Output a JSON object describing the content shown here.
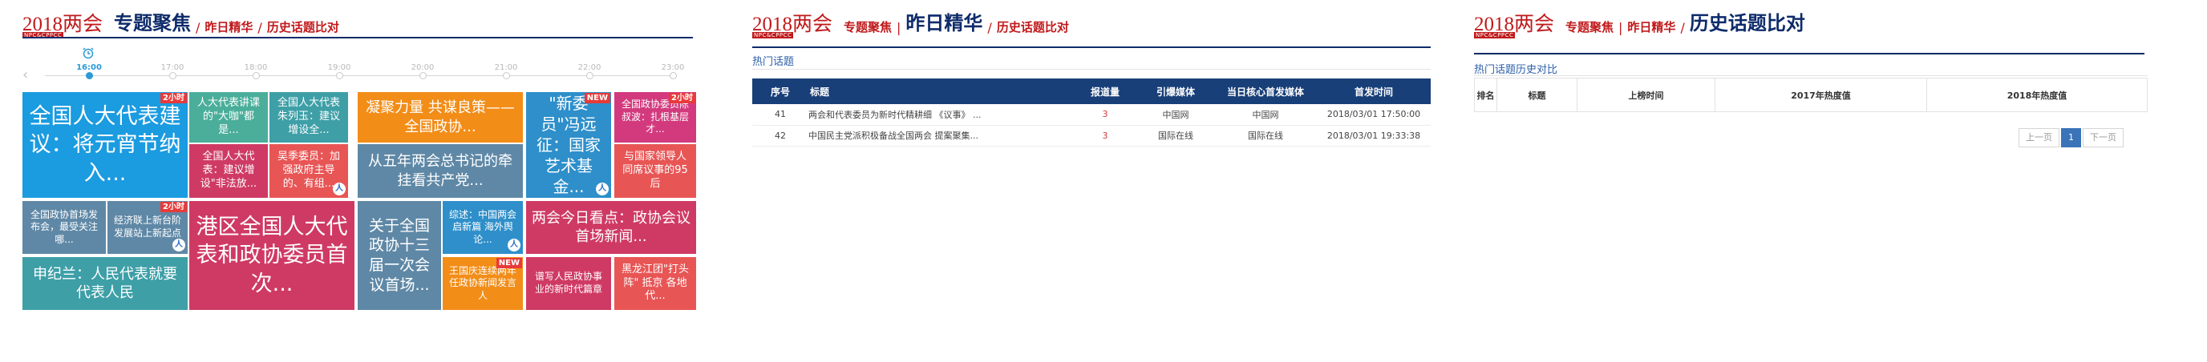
{
  "brand": {
    "year_text": "2018",
    "lianghui_text": "两会",
    "en_text": "NPC&CPPCC"
  },
  "panel1": {
    "title": "专题聚焦",
    "links": [
      "昨日精华",
      "历史话题比对"
    ],
    "timeline": {
      "clock_icon": "alarm-clock-icon",
      "times": [
        "16:00",
        "17:00",
        "18:00",
        "19:00",
        "20:00",
        "21:00",
        "22:00",
        "23:00"
      ],
      "active_index": 0
    },
    "tiles": [
      {
        "text": "全国人大代表建议：将元宵节纳入...",
        "badge": "2小时"
      },
      {
        "text": "人大代表讲课的\"大咖\"都是..."
      },
      {
        "text": "全国人大代表朱列玉：建议增设全..."
      },
      {
        "text": "凝聚力量 共谋良策——全国政协..."
      },
      {
        "text": "\"新委员\"冯远征：国家艺术基金...",
        "badge": "NEW"
      },
      {
        "text": "全国政协委员陈叔波：扎根基层才...",
        "badge": "2小时"
      },
      {
        "text": "全国人大代表：建议增设\"非法放..."
      },
      {
        "text": "吴季委员：加强政府主导的、有组..."
      },
      {
        "text": "从五年两会总书记的牵挂看共产党..."
      },
      {
        "text": "与国家领导人同席议事的95后"
      },
      {
        "text": "全国政协首场发布会，最受关注哪..."
      },
      {
        "text": "经济联上新台阶 发展站上新起点",
        "badge": "2小时"
      },
      {
        "text": "港区全国人大代表和政协委员首次..."
      },
      {
        "text": "关于全国政协十三届一次会议首场..."
      },
      {
        "text": "综述：中国两会启新篇 海外舆论..."
      },
      {
        "text": "两会今日看点：政协会议首场新闻..."
      },
      {
        "text": "申纪兰：人民代表就要代表人民"
      },
      {
        "text": "王国庆连续两年任政协新闻发言人",
        "badge": "NEW"
      },
      {
        "text": "谱写人民政协事业的新时代篇章"
      },
      {
        "text": "黑龙江团\"打头阵\" 抵京 各地代..."
      }
    ]
  },
  "panel2": {
    "title": "昨日精华",
    "links": [
      "专题聚焦",
      "历史话题比对"
    ],
    "subtitle": "热门话题",
    "columns": [
      "序号",
      "标题",
      "报道量",
      "引爆媒体",
      "当日核心首发媒体",
      "首发时间"
    ],
    "rows": [
      [
        "41",
        "两会和代表委员为新时代精耕细  《议事》 ...",
        "3",
        "中国网",
        "中国网",
        "2018/03/01 17:50:00"
      ],
      [
        "42",
        "中国民主党派积极备战全国两会 提案聚集...",
        "3",
        "国际在线",
        "国际在线",
        "2018/03/01 19:33:38"
      ]
    ]
  },
  "panel3": {
    "title": "历史话题比对",
    "links": [
      "专题聚焦",
      "昨日精华"
    ],
    "subtitle": "热门话题历史对比",
    "columns": [
      "排名",
      "标题",
      "上榜时间",
      "2017年热度值",
      "2018年热度值"
    ],
    "pager": {
      "prev": "上一页",
      "page": "1",
      "next": "下一页"
    }
  },
  "colors": {
    "brand_red": "#c0191b",
    "navy": "#0e2b6a",
    "accent_blue": "#2b9ad8",
    "table_header": "#183f78"
  }
}
